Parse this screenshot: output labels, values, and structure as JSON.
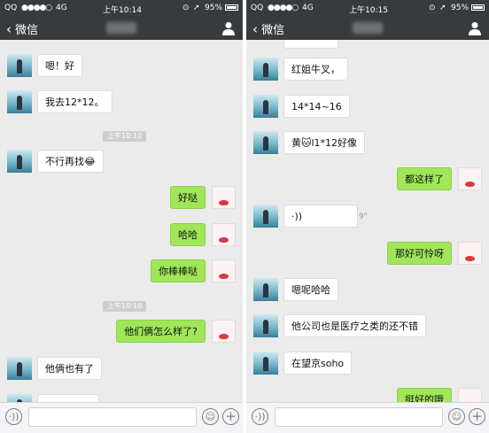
{
  "left": {
    "status": {
      "carrier": "QQ",
      "signal": "●●●●○",
      "network": "4G",
      "time": "上午10:14",
      "battery": "95%"
    },
    "nav": {
      "back_label": "微信"
    },
    "messages": [
      {
        "side": "in",
        "text": "嗯！好"
      },
      {
        "side": "in",
        "text": "我去12*12。"
      },
      {
        "side": "time",
        "text": "上午10:10"
      },
      {
        "side": "in",
        "text": "不行再找😂"
      },
      {
        "side": "out",
        "text": "好哒"
      },
      {
        "side": "out",
        "text": "哈哈"
      },
      {
        "side": "out",
        "text": "你棒棒哒"
      },
      {
        "side": "time",
        "text": "上午10:10"
      },
      {
        "side": "out",
        "text": "他们俩怎么样了?"
      },
      {
        "side": "in",
        "text": "他俩也有了"
      }
    ]
  },
  "right": {
    "status": {
      "carrier": "QQ",
      "signal": "●●●●○",
      "network": "4G",
      "time": "上午10:15",
      "battery": "95%"
    },
    "nav": {
      "back_label": "微信"
    },
    "messages": [
      {
        "side": "in",
        "text": "红姐牛叉，"
      },
      {
        "side": "in",
        "text": "14*14~16"
      },
      {
        "side": "in",
        "text": "黄🐱l1*12好像"
      },
      {
        "side": "out",
        "text": "都这样了"
      },
      {
        "side": "voice",
        "text": "·))",
        "duration": "9\""
      },
      {
        "side": "out",
        "text": "那好可怜呀"
      },
      {
        "side": "in",
        "text": "嗯呢哈哈"
      },
      {
        "side": "in",
        "text": "他公司也是医疗之类的还不错"
      },
      {
        "side": "in",
        "text": "在望京soho"
      },
      {
        "side": "out",
        "text": "挺好的哦"
      }
    ]
  },
  "icons": {
    "back": "chevron-left-icon",
    "contact": "person-icon",
    "voice": "voice-icon",
    "emoji": "emoji-icon",
    "plus": "plus-icon",
    "location": "location-arrow-icon",
    "lock": "rotation-lock-icon"
  },
  "colors": {
    "nav_bg": "#383b3e",
    "chat_bg": "#ebebeb",
    "bubble_out": "#9fe658",
    "bubble_in": "#ffffff"
  }
}
